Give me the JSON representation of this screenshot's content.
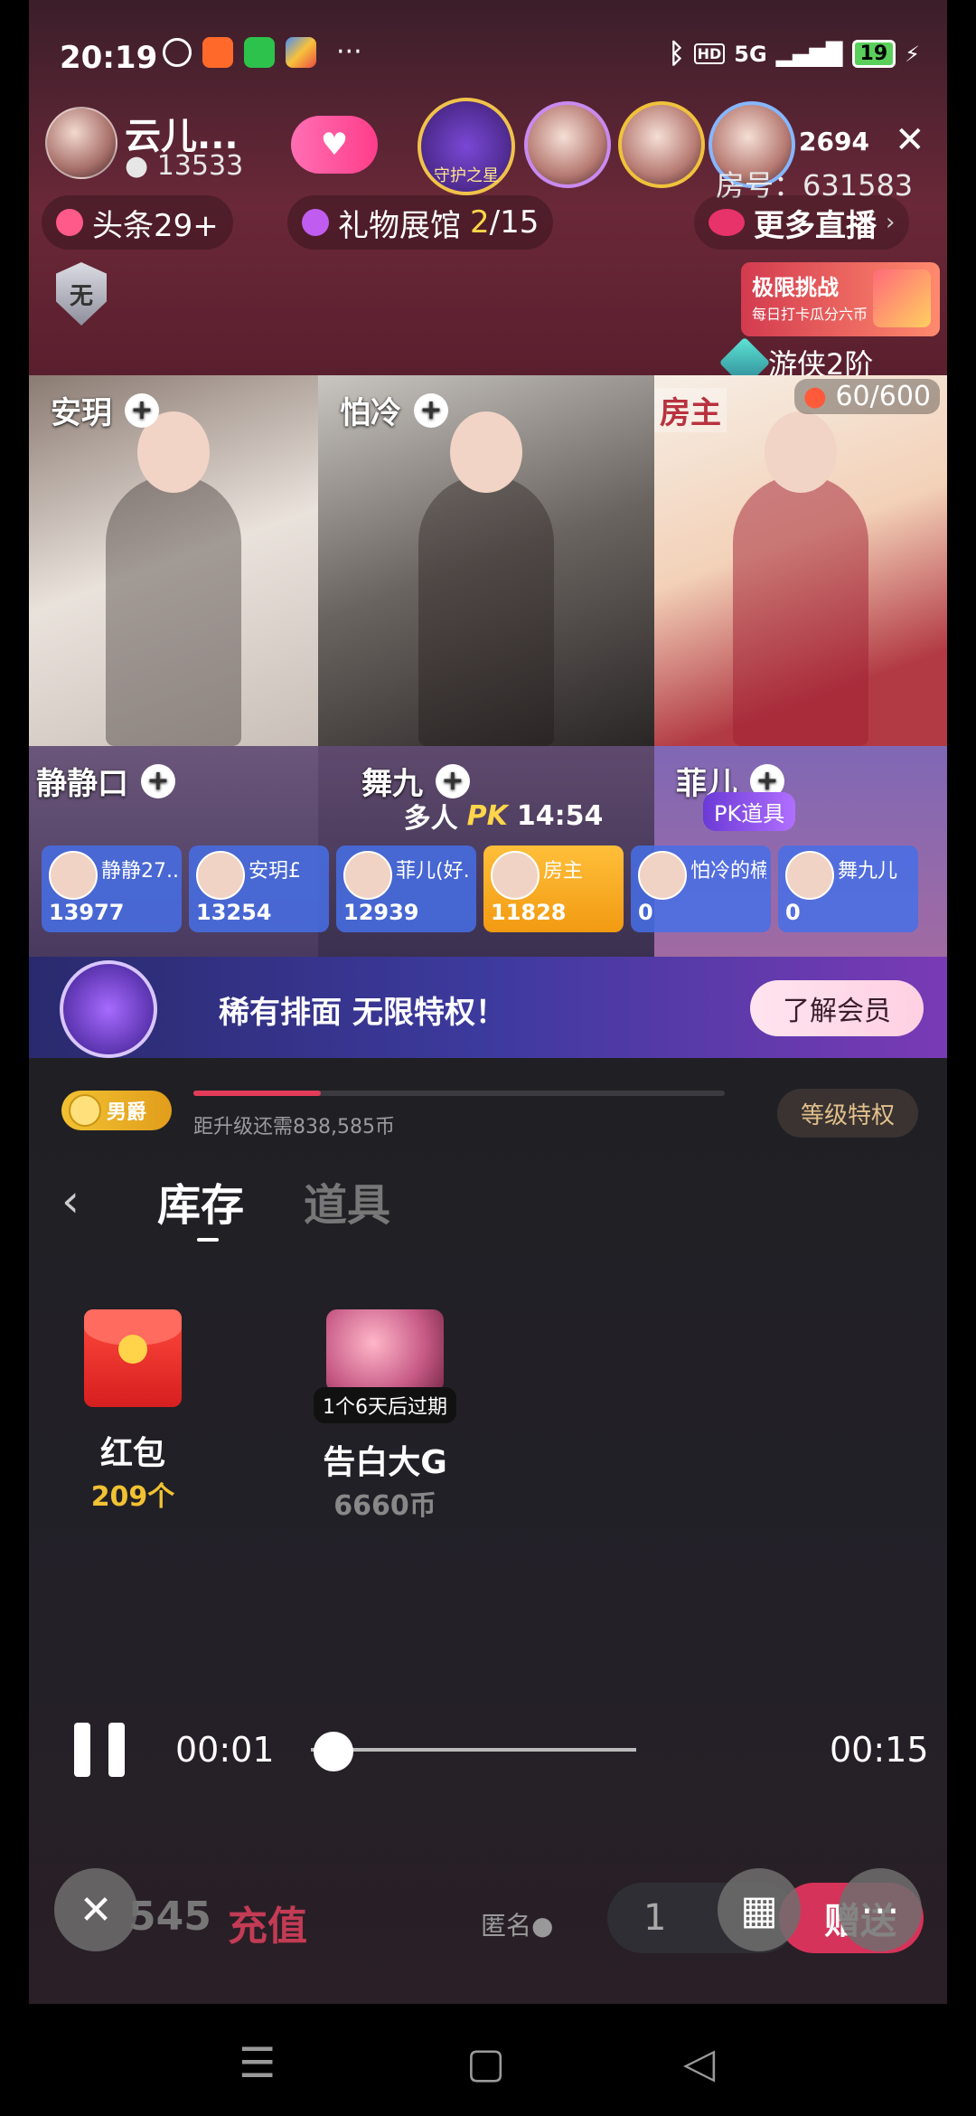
{
  "status_bar": {
    "time": "20:19",
    "more": "···",
    "network1": "HD",
    "network2": "5G",
    "battery": "19"
  },
  "host": {
    "name": "云儿...",
    "fans": "13533"
  },
  "badge_label": "守护之星",
  "viewer_count": "2694",
  "room_no": "房号：631583",
  "chips": {
    "headline": "头条29+",
    "gifts_prefix": "礼物展馆",
    "gifts_count": "2",
    "gifts_total": "/15",
    "more_live": "更多直播"
  },
  "shield_text": "无",
  "challenge": {
    "title": "极限挑战",
    "subtitle": "每日打卡瓜分六币"
  },
  "ranger": {
    "label": "游侠2阶",
    "progress": "60/600"
  },
  "seats": [
    {
      "name": "安玥"
    },
    {
      "name": "怕冷"
    },
    {
      "name": "房主"
    },
    {
      "name": "静静口"
    },
    {
      "name": "舞九"
    },
    {
      "name": "菲儿"
    }
  ],
  "pk": {
    "prefix": "多人",
    "logo": "PK",
    "timer": "14:54",
    "prop_label": "PK道具"
  },
  "scores": [
    {
      "name": "静静27...",
      "value": "13977"
    },
    {
      "name": "安玥£",
      "value": "13254"
    },
    {
      "name": "菲儿(好...",
      "value": "12939"
    },
    {
      "name": "房主",
      "value": "11828"
    },
    {
      "name": "怕冷的楠",
      "value": "0"
    },
    {
      "name": "舞九儿",
      "value": "0"
    }
  ],
  "vip": {
    "text": "稀有排面  无限特权！",
    "button": "了解会员"
  },
  "level": {
    "badge": "男爵",
    "progress_label": "距升级还需838,585币",
    "progress_fraction": 0.24,
    "privileges": "等级特权"
  },
  "tabs": {
    "inventory": "库存",
    "props": "道具"
  },
  "items": [
    {
      "name": "红包",
      "sub": "209个"
    },
    {
      "name": "告白大G",
      "sub": "6660币",
      "expire": "1个6天后过期"
    }
  ],
  "player": {
    "current": "00:01",
    "total": "00:15",
    "progress_fraction": 0.07
  },
  "bottom": {
    "balance": "545",
    "recharge": "充值",
    "anonymous": "匿名",
    "quantity": "1",
    "send": "赠送"
  }
}
